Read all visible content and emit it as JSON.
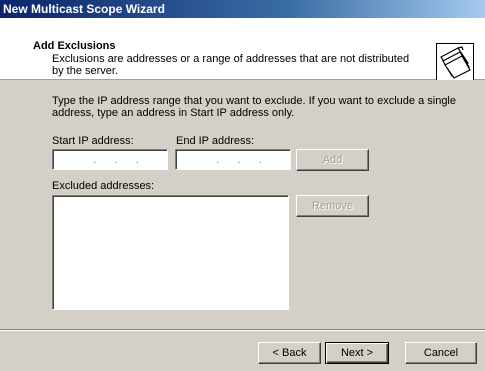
{
  "window": {
    "title": "New Multicast Scope Wizard"
  },
  "header": {
    "title": "Add Exclusions",
    "description": "Exclusions are addresses or a range of addresses that are not distributed by the server.",
    "icon": "wizard-folders-icon"
  },
  "body": {
    "instruction": "Type the IP address range that you want to exclude. If you want to exclude a single address, type an address in Start IP address only.",
    "start_ip_label": "Start IP address:",
    "start_ip_value": ".      .      .",
    "end_ip_label": "End IP address:",
    "end_ip_value": ".      .      .",
    "add_label": "Add",
    "excluded_label": "Excluded addresses:",
    "remove_label": "Remove"
  },
  "footer": {
    "back_label": "< Back",
    "next_label": "Next >",
    "cancel_label": "Cancel"
  }
}
